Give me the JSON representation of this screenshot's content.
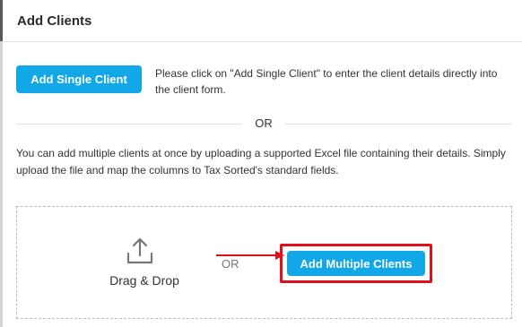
{
  "modal": {
    "title": "Add Clients"
  },
  "single": {
    "button_label": "Add Single Client",
    "description": "Please click on \"Add Single Client\" to enter the client details directly into the client form."
  },
  "divider": {
    "text": "OR"
  },
  "multiple": {
    "description": "You can add multiple clients at once by uploading a supported Excel file containing their details. Simply upload the file and map the columns to Tax Sorted's standard fields."
  },
  "dropzone": {
    "label": "Drag & Drop",
    "or_text": "OR",
    "button_label": "Add Multiple Clients",
    "icon": "upload-icon"
  },
  "colors": {
    "accent": "#12a8e8",
    "highlight": "#e0101a"
  }
}
